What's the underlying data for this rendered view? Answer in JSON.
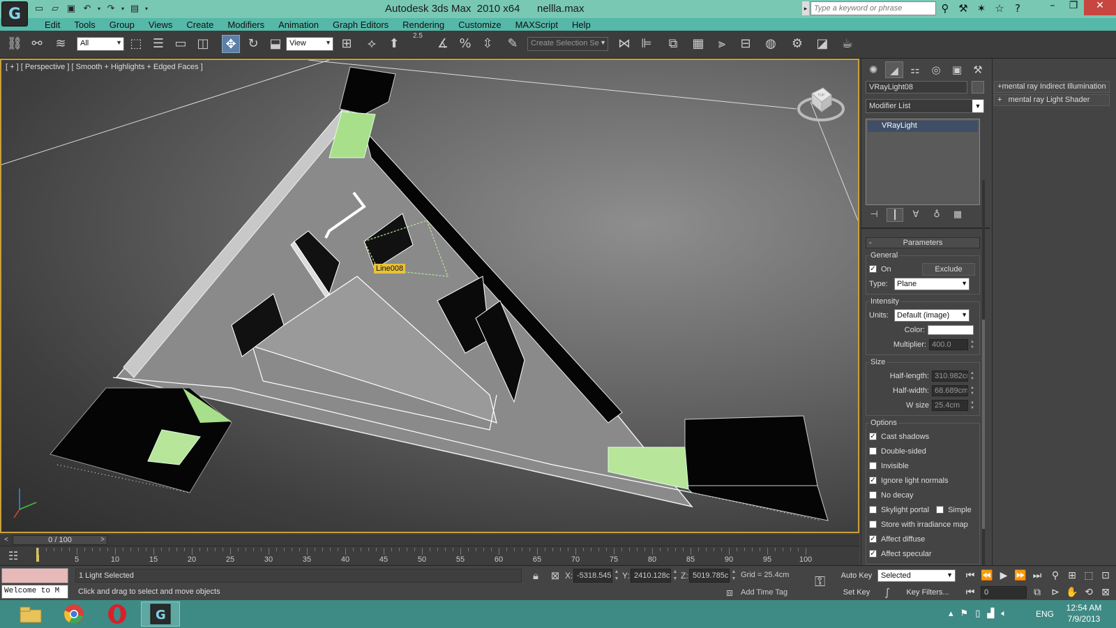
{
  "app": {
    "title": "Autodesk 3ds Max  2010 x64",
    "filename": "nellla.max",
    "search_placeholder": "Type a keyword or phrase"
  },
  "menu": [
    "Edit",
    "Tools",
    "Group",
    "Views",
    "Create",
    "Modifiers",
    "Animation",
    "Graph Editors",
    "Rendering",
    "Customize",
    "MAXScript",
    "Help"
  ],
  "toolbar": {
    "selection_filter": "All",
    "reference_coord": "View",
    "snap_angle": "2.5",
    "named_selection_placeholder": "Create Selection Se"
  },
  "viewport": {
    "label": "[ + ] [ Perspective ] [ Smooth + Highlights + Edged Faces ]",
    "object_label": "Line008",
    "axis_x": "x",
    "axis_y": "y",
    "viewcube_face": "TOP"
  },
  "timeslider": {
    "position": "0 / 100",
    "ticks": [
      "5",
      "10",
      "15",
      "20",
      "25",
      "30",
      "35",
      "40",
      "45",
      "50",
      "55",
      "60",
      "65",
      "70",
      "75",
      "80",
      "85",
      "90",
      "95",
      "100"
    ]
  },
  "status": {
    "maxscript_text": "Welcome to M",
    "selection": "1 Light Selected",
    "prompt": "Click and drag to select and move objects",
    "x_label": "X:",
    "x_value": "-5318.545",
    "y_label": "Y:",
    "y_value": "2410.128c",
    "z_label": "Z:",
    "z_value": "5019.785c",
    "grid": "Grid = 25.4cm",
    "add_time_tag": "Add Time Tag",
    "auto_key": "Auto Key",
    "set_key": "Set Key",
    "key_mode": "Selected",
    "key_filters": "Key Filters...",
    "frame": "0"
  },
  "command_panel": {
    "object_name": "VRayLight08",
    "modifier_list": "Modifier List",
    "stack_item": "VRayLight",
    "rollout_title": "Parameters",
    "general": {
      "label": "General",
      "on_label": "On",
      "on_checked": true,
      "exclude_label": "Exclude",
      "type_label": "Type:",
      "type_value": "Plane"
    },
    "intensity": {
      "label": "Intensity",
      "units_label": "Units:",
      "units_value": "Default (image)",
      "color_label": "Color:",
      "multiplier_label": "Multiplier:",
      "multiplier_value": "400.0"
    },
    "size": {
      "label": "Size",
      "half_length_label": "Half-length:",
      "half_length_value": "310.982cı",
      "half_width_label": "Half-width:",
      "half_width_value": "68.689cm",
      "w_size_label": "W size",
      "w_size_value": "25.4cm"
    },
    "options": {
      "label": "Options",
      "items": [
        {
          "label": "Cast shadows",
          "checked": true
        },
        {
          "label": "Double-sided",
          "checked": false
        },
        {
          "label": "Invisible",
          "checked": false
        },
        {
          "label": "Ignore light normals",
          "checked": true
        },
        {
          "label": "No decay",
          "checked": false
        },
        {
          "label": "Skylight portal",
          "checked": false
        },
        {
          "label": "Store with irradiance map",
          "checked": false
        },
        {
          "label": "Affect diffuse",
          "checked": true
        },
        {
          "label": "Affect specular",
          "checked": true
        }
      ],
      "simple_label": "Simple"
    }
  },
  "shader_panel": {
    "items": [
      "mental ray Indirect Illumination",
      "mental ray Light Shader"
    ]
  },
  "taskbar": {
    "apps": [
      "explorer-icon",
      "chrome-icon",
      "opera-icon",
      "3dsmax-icon"
    ],
    "language": "ENG",
    "time": "12:54 AM",
    "date": "7/9/2013"
  },
  "colors": {
    "titlebar": "#78c8b4",
    "menubar": "#55b8a8",
    "viewport_border": "#c7a03a",
    "object_label_bg": "#e8c23a",
    "taskbar": "#3e8a84",
    "light_green": "#b7e59a"
  }
}
